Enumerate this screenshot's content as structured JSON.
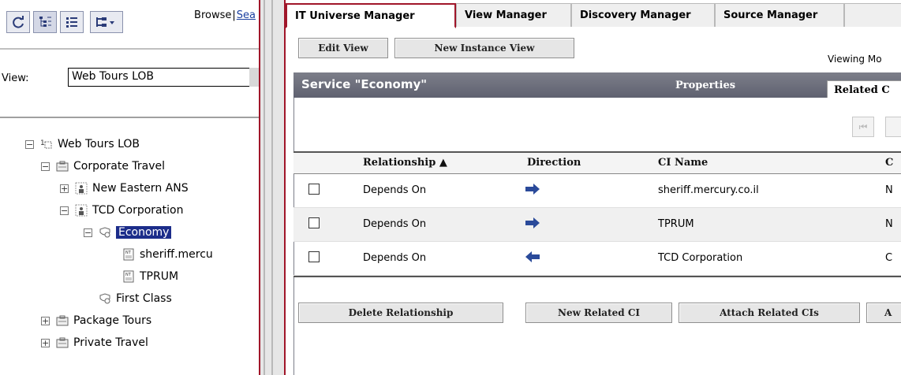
{
  "left": {
    "browse_label": "Browse",
    "search_label": "Sea",
    "view_label": "View:",
    "view_value": "Web Tours LOB",
    "tree": [
      {
        "label": "Web Tours LOB",
        "expander": "−",
        "icon": "view-icon",
        "level": 0
      },
      {
        "label": "Corporate Travel",
        "expander": "−",
        "icon": "business-unit-icon",
        "level": 1
      },
      {
        "label": "New Eastern ANS",
        "expander": "+",
        "icon": "group-icon",
        "level": 2
      },
      {
        "label": "TCD Corporation",
        "expander": "−",
        "icon": "group-icon",
        "level": 2
      },
      {
        "label": "Economy",
        "expander": "−",
        "icon": "service-icon",
        "level": 3,
        "selected": true
      },
      {
        "label": "sheriff.mercu",
        "expander": "",
        "icon": "host-icon",
        "level": 4
      },
      {
        "label": "TPRUM",
        "expander": "",
        "icon": "host-icon",
        "level": 4
      },
      {
        "label": "First Class",
        "expander": "",
        "icon": "service-icon",
        "level": 3
      },
      {
        "label": "Package Tours",
        "expander": "+",
        "icon": "business-unit-icon",
        "level": 1
      },
      {
        "label": "Private Travel",
        "expander": "+",
        "icon": "business-unit-icon",
        "level": 1
      }
    ]
  },
  "tabs": [
    {
      "label": "IT Universe Manager",
      "active": true
    },
    {
      "label": "View Manager",
      "active": false
    },
    {
      "label": "Discovery Manager",
      "active": false
    },
    {
      "label": "Source Manager",
      "active": false
    }
  ],
  "toolbar": {
    "edit_view": "Edit View",
    "new_instance_view": "New Instance View",
    "viewing": "Viewing Mo"
  },
  "panel": {
    "title": "Service \"Economy\"",
    "properties_tab": "Properties",
    "related_tab": "Related C"
  },
  "table": {
    "headers": {
      "relationship": "Relationship ▲",
      "direction": "Direction",
      "ci_name": "CI Name",
      "extra": "C"
    },
    "rows": [
      {
        "relationship": "Depends On",
        "direction": "out",
        "ci_name": "sheriff.mercury.co.il",
        "extra": "N"
      },
      {
        "relationship": "Depends On",
        "direction": "out",
        "ci_name": "TPRUM",
        "extra": "N"
      },
      {
        "relationship": "Depends On",
        "direction": "in",
        "ci_name": "TCD Corporation",
        "extra": "C"
      }
    ]
  },
  "actions": {
    "delete_relationship": "Delete Relationship",
    "new_related_ci": "New Related CI",
    "attach_related_cis": "Attach Related CIs",
    "more": "A"
  },
  "colors": {
    "accent": "#a0162a",
    "selection": "#1c2d8a",
    "arrow": "#2a4a9a"
  }
}
